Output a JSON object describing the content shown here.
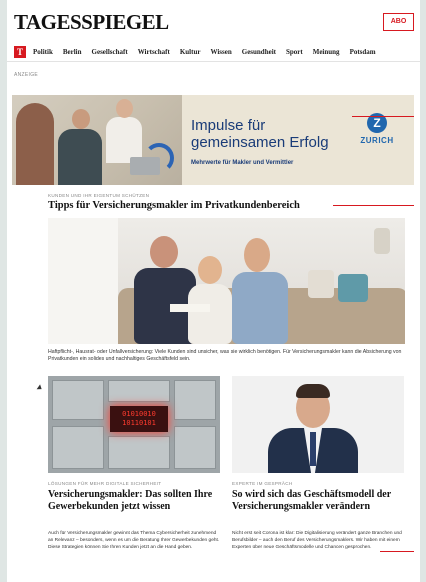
{
  "header": {
    "logo": "TAGESSPIEGEL",
    "abo_label": "ABO",
    "brand_color": "#d71920"
  },
  "nav": {
    "logo_letter": "T",
    "items": [
      "Politik",
      "Berlin",
      "Gesellschaft",
      "Wirtschaft",
      "Kultur",
      "Wissen",
      "Gesundheit",
      "Sport",
      "Meinung",
      "Potsdam"
    ]
  },
  "ad_label": "ANZEIGE",
  "banner": {
    "headline_line1": "Impulse für",
    "headline_line2": "gemeinsamen Erfolg",
    "subline": "Mehrwerte für Makler und Vermittler",
    "sponsor_mark": "Z",
    "sponsor_name": "ZURICH",
    "accent_color": "#1a3c78"
  },
  "main_article": {
    "kicker": "KUNDEN UND IHR EIGENTUM SCHÜTZEN",
    "title": "Tipps für Versicherungsmakler im Privatkundenbereich",
    "caption": "Haftpflicht-, Hausrat- oder Unfallversicherung: Viele Kunden sind unsicher, was sie wirklich benötigen. Für Versicherungsmakler kann die Absicherung von Privatkunden ein solides und nachhaltiges Geschäftsfeld sein."
  },
  "cards": [
    {
      "image_text": "01010010\n10110101",
      "kicker": "LÖSUNGEN FÜR MEHR DIGITALE SICHERHEIT",
      "title": "Versicherungsmakler: Das sollten Ihre Gewerbekunden jetzt wissen",
      "text": "Auch für Versicherungsmakler gewinnt das Thema Cybersicherheit zunehmend an Relevanz – besonders, wenn es um die Beratung Ihrer Gewerbekunden geht. Diese Strategien können Sie Ihren Kunden jetzt an die Hand geben."
    },
    {
      "kicker": "EXPERTE IM GESPRÄCH",
      "title": "So wird sich das Geschäftsmodell der Versicherungsmakler verändern",
      "text": "Nicht erst seit Corona ist klar: Die Digitalisierung verändert ganze Branchen und Berufsbilder – auch den Beruf des Versicherungsmaklers. Wir haben mit einem Experten über neue Geschäftsmodelle und Chancen gesprochen."
    }
  ]
}
